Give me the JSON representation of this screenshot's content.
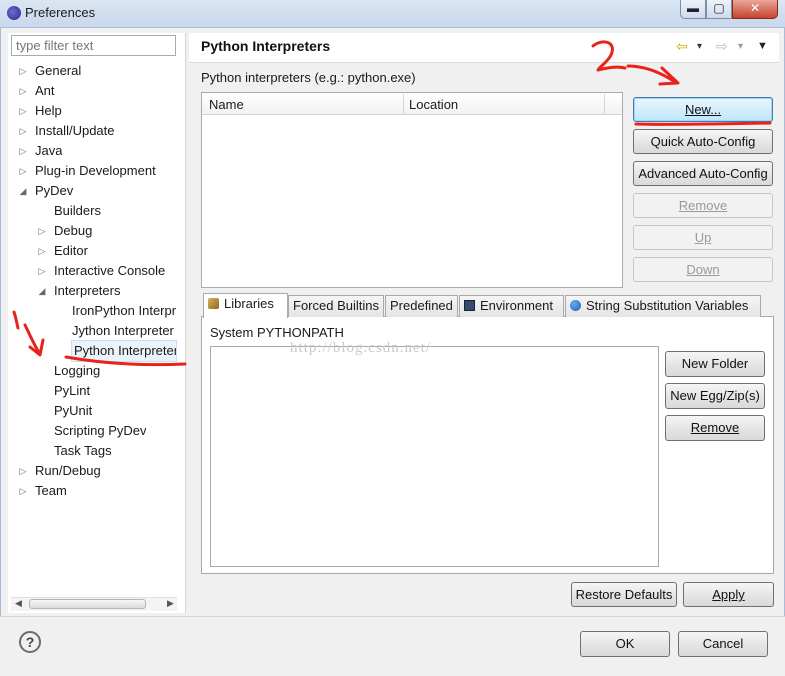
{
  "window": {
    "title": "Preferences",
    "minimize": "▬",
    "maximize": "▢",
    "close": "✕"
  },
  "filter": {
    "placeholder": "type filter text"
  },
  "tree": [
    {
      "label": "General",
      "arrow": "▷",
      "level": 0
    },
    {
      "label": "Ant",
      "arrow": "▷",
      "level": 0
    },
    {
      "label": "Help",
      "arrow": "▷",
      "level": 0
    },
    {
      "label": "Install/Update",
      "arrow": "▷",
      "level": 0
    },
    {
      "label": "Java",
      "arrow": "▷",
      "level": 0
    },
    {
      "label": "Plug-in Development",
      "arrow": "▷",
      "level": 0
    },
    {
      "label": "PyDev",
      "arrow": "◢",
      "level": 0
    },
    {
      "label": "Builders",
      "arrow": "",
      "level": 1
    },
    {
      "label": "Debug",
      "arrow": "▷",
      "level": 1
    },
    {
      "label": "Editor",
      "arrow": "▷",
      "level": 1
    },
    {
      "label": "Interactive Console",
      "arrow": "▷",
      "level": 1
    },
    {
      "label": "Interpreters",
      "arrow": "◢",
      "level": 1
    },
    {
      "label": "IronPython Interpreter",
      "arrow": "",
      "level": 2
    },
    {
      "label": "Jython Interpreter",
      "arrow": "",
      "level": 2
    },
    {
      "label": "Python Interpreter",
      "arrow": "",
      "level": 2,
      "selected": true
    },
    {
      "label": "Logging",
      "arrow": "",
      "level": 1
    },
    {
      "label": "PyLint",
      "arrow": "",
      "level": 1
    },
    {
      "label": "PyUnit",
      "arrow": "",
      "level": 1
    },
    {
      "label": "Scripting PyDev",
      "arrow": "",
      "level": 1
    },
    {
      "label": "Task Tags",
      "arrow": "",
      "level": 1
    },
    {
      "label": "Run/Debug",
      "arrow": "▷",
      "level": 0
    },
    {
      "label": "Team",
      "arrow": "▷",
      "level": 0
    }
  ],
  "page": {
    "title": "Python Interpreters",
    "subtitle": "Python interpreters (e.g.: python.exe)",
    "columns": [
      "Name",
      "Location"
    ],
    "nav": {
      "back": "⇦",
      "forward": "⇨",
      "dropdown": "▾",
      "menu": "▼"
    }
  },
  "interp_buttons": {
    "new": "New...",
    "quick": "Quick Auto-Config",
    "advanced": "Advanced Auto-Config",
    "remove": "Remove",
    "up": "Up",
    "down": "Down"
  },
  "tabs": [
    "Libraries",
    "Forced Builtins",
    "Predefined",
    "Environment",
    "String Substitution Variables"
  ],
  "libraries": {
    "label": "System PYTHONPATH",
    "new_folder": "New Folder",
    "new_egg": "New Egg/Zip(s)",
    "remove": "Remove"
  },
  "watermark": "http://blog.csdn.net/",
  "footer": {
    "restore": "Restore Defaults",
    "apply": "Apply",
    "ok": "OK",
    "cancel": "Cancel",
    "help": "?"
  },
  "colors": {
    "annotation": "#e8231a",
    "selection": "#eaf3fc",
    "focus_border": "#3c7fb1"
  }
}
